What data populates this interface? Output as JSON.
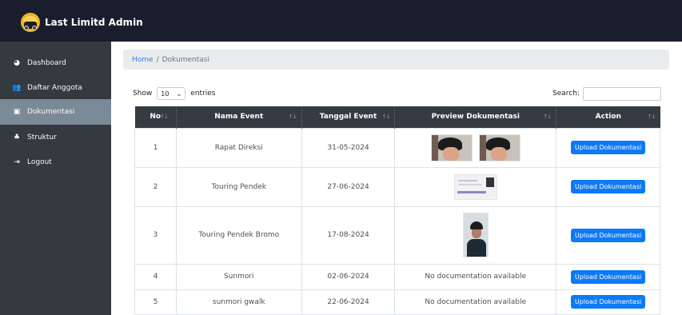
{
  "app": {
    "title": "Last Limitd Admin"
  },
  "sidebar": {
    "items": [
      {
        "label": "Dashboard",
        "icon": "dashboard-icon",
        "glyph": "◕",
        "active": false
      },
      {
        "label": "Daftar Anggota",
        "icon": "users-icon",
        "glyph": "👥",
        "active": false
      },
      {
        "label": "Dokumentasi",
        "icon": "camera-icon",
        "glyph": "▣",
        "active": true
      },
      {
        "label": "Struktur",
        "icon": "sitemap-icon",
        "glyph": "♣",
        "active": false
      },
      {
        "label": "Logout",
        "icon": "logout-icon",
        "glyph": "⇥",
        "active": false
      }
    ]
  },
  "breadcrumb": {
    "home": "Home",
    "separator": "/",
    "current": "Dokumentasi"
  },
  "table_controls": {
    "show_label": "Show",
    "entries_value": "10",
    "entries_label": "entries",
    "search_label": "Search:",
    "search_value": ""
  },
  "table": {
    "columns": [
      "No",
      "Nama Event",
      "Tanggal Event",
      "Preview Dokumentasi",
      "Action"
    ],
    "sort_glyph": "↑↓",
    "rows": [
      {
        "no": "1",
        "event": "Rapat Direksi",
        "date": "31-05-2024",
        "preview": "images",
        "action": "Upload Dokumentasi"
      },
      {
        "no": "2",
        "event": "Touring Pendek",
        "date": "27-06-2024",
        "preview": "image",
        "action": "Upload Dokumentasi"
      },
      {
        "no": "3",
        "event": "Touring Pendek Bromo",
        "date": "17-08-2024",
        "preview": "image",
        "action": "Upload Dokumentasi"
      },
      {
        "no": "4",
        "event": "Sunmori",
        "date": "02-06-2024",
        "preview": "No documentation available",
        "action": "Upload Dokumentasi"
      },
      {
        "no": "5",
        "event": "sunmori gwalk",
        "date": "22-06-2024",
        "preview": "No documentation available",
        "action": "Upload Dokumentasi"
      }
    ]
  },
  "colors": {
    "topbar": "#1a1d2b",
    "sidebar": "#343a40",
    "sidebar_active": "#7b8a97",
    "table_header": "#353b42",
    "primary_button": "#0d7af8",
    "link": "#2f7de1"
  }
}
